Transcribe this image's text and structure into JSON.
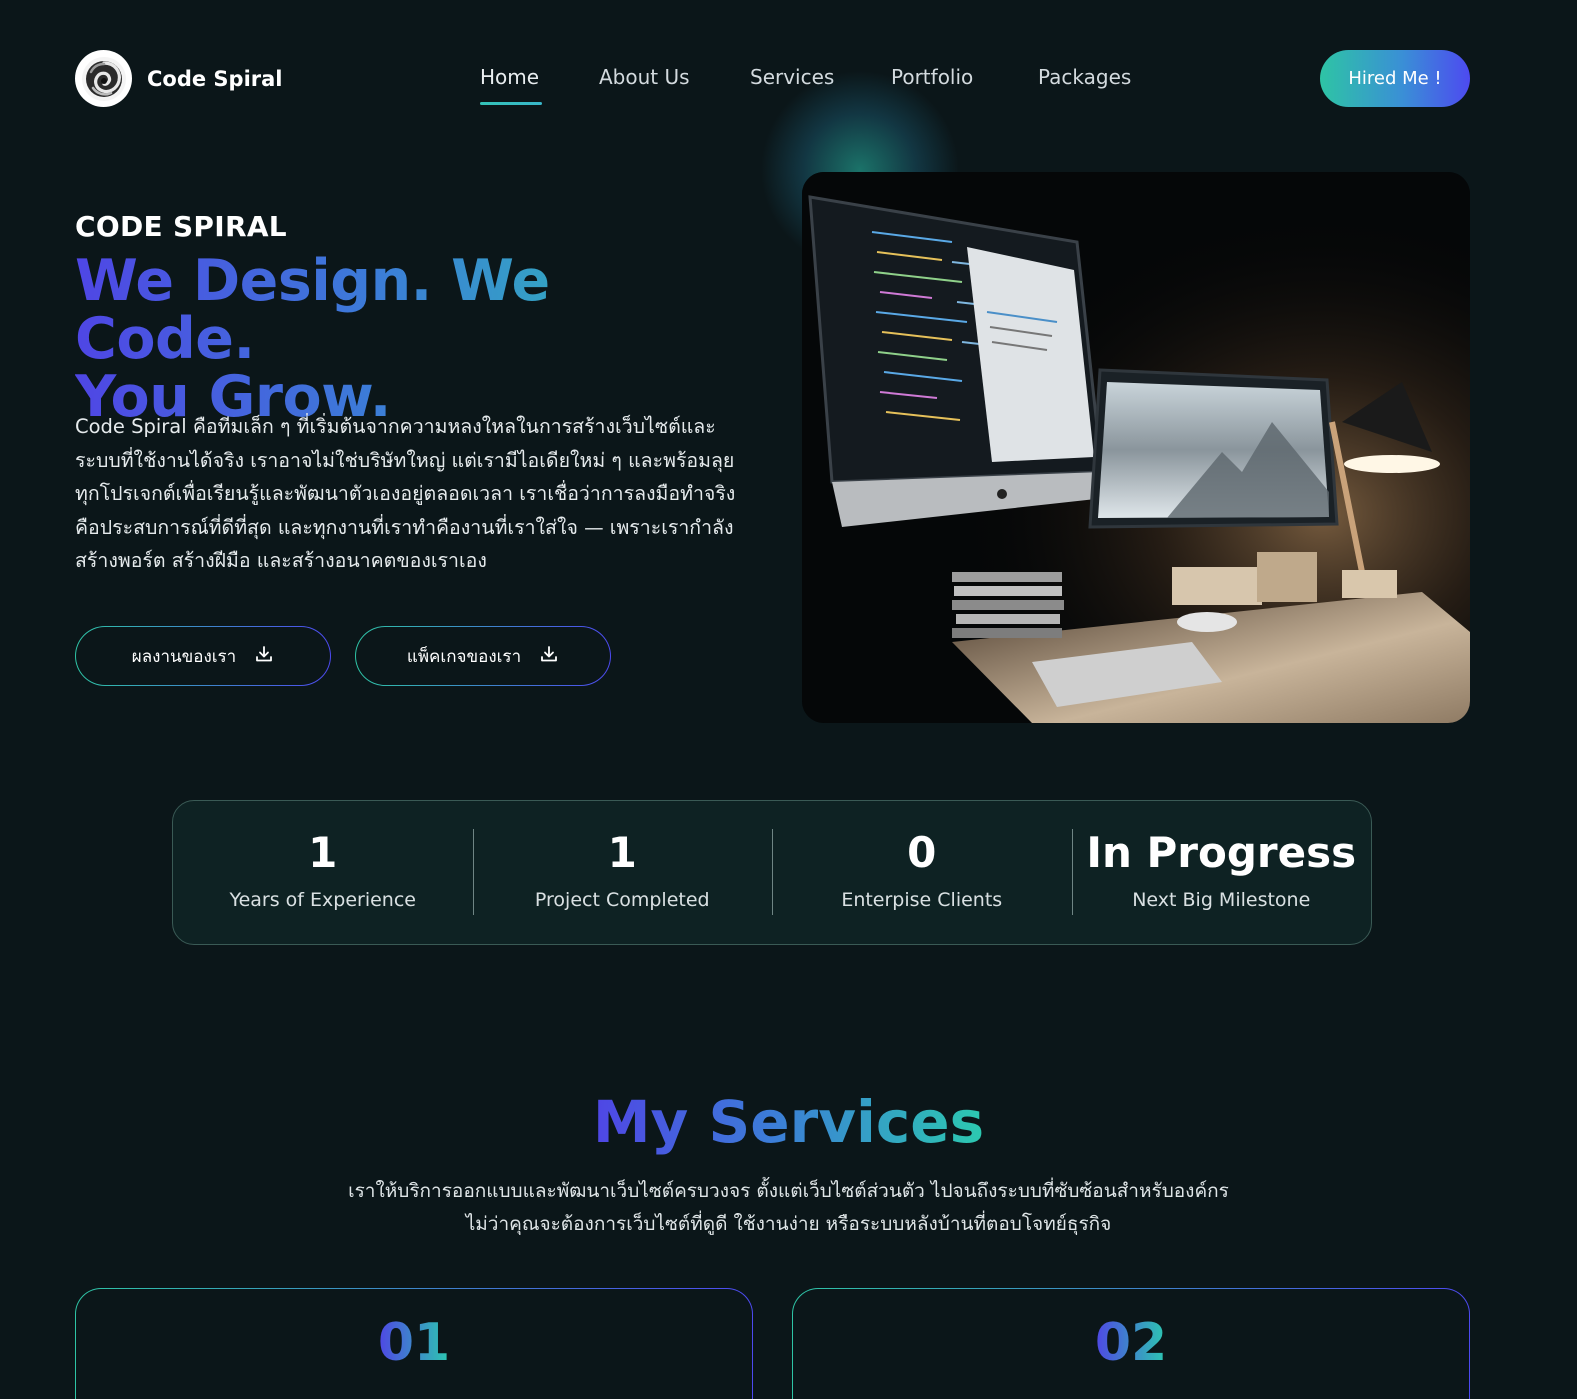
{
  "brand": {
    "name": "Code Spiral"
  },
  "nav": {
    "items": [
      {
        "label": "Home",
        "active": true
      },
      {
        "label": "About Us"
      },
      {
        "label": "Services"
      },
      {
        "label": "Portfolio"
      },
      {
        "label": "Packages"
      }
    ],
    "cta_label": "Hired Me !"
  },
  "hero": {
    "eyebrow": "CODE SPIRAL",
    "headline_line1": "We Design. We Code.",
    "headline_line2": "You Grow.",
    "description": "Code Spiral คือทีมเล็ก ๆ ที่เริ่มต้นจากความหลงใหลในการสร้างเว็บไซต์และระบบที่ใช้งานได้จริง เราอาจไม่ใช่บริษัทใหญ่ แต่เรามีไอเดียใหม่ ๆ และพร้อมลุยทุกโปรเจกต์เพื่อเรียนรู้และพัฒนาตัวเองอยู่ตลอดเวลา เราเชื่อว่าการลงมือทำจริงคือประสบการณ์ที่ดีที่สุด และทุกงานที่เราทำคืองานที่เราใส่ใจ — เพราะเรากำลังสร้างพอร์ต สร้างฝีมือ และสร้างอนาคตของเราเอง",
    "buttons": [
      {
        "label": "ผลงานของเรา",
        "icon": "download-icon"
      },
      {
        "label": "แพ็คเกจของเรา",
        "icon": "download-icon"
      }
    ]
  },
  "stats": [
    {
      "value": "1",
      "label": "Years of Experience"
    },
    {
      "value": "1",
      "label": "Project Completed"
    },
    {
      "value": "0",
      "label": "Enterpise Clients"
    },
    {
      "value": "In Progress",
      "label": "Next Big Milestone"
    }
  ],
  "services": {
    "title": "My Services",
    "description_line1": "เราให้บริการออกแบบและพัฒนาเว็บไซต์ครบวงจร ตั้งแต่เว็บไซต์ส่วนตัว ไปจนถึงระบบที่ซับซ้อนสำหรับองค์กร",
    "description_line2": "ไม่ว่าคุณจะต้องการเว็บไซต์ที่ดูดี ใช้งานง่าย หรือระบบหลังบ้านที่ตอบโจทย์ธุรกิจ",
    "cards": [
      {
        "number": "01"
      },
      {
        "number": "02"
      }
    ]
  },
  "colors": {
    "background": "#0b1619",
    "accent_teal": "#2cc9b0",
    "accent_indigo": "#4f46e5",
    "stats_panel": "#0e2223"
  }
}
